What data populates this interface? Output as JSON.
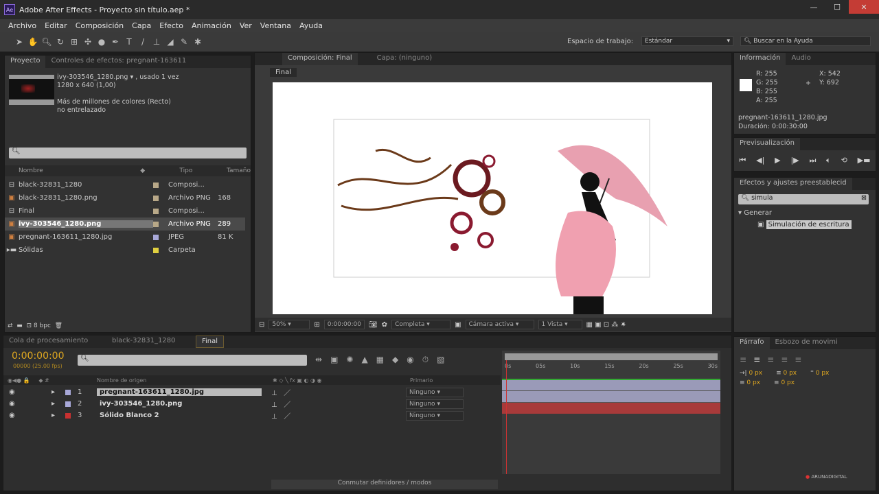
{
  "window": {
    "title": "Adobe After Effects - Proyecto sin título.aep *",
    "logo": "Ae"
  },
  "menu": [
    "Archivo",
    "Editar",
    "Composición",
    "Capa",
    "Efecto",
    "Animación",
    "Ver",
    "Ventana",
    "Ayuda"
  ],
  "toolbar": {
    "workspace_label": "Espacio de trabajo:",
    "workspace_value": "Estándar",
    "help_search": "Buscar en la Ayuda"
  },
  "project": {
    "tab": "Proyecto",
    "effects_tab": "Controles de efectos: pregnant-163611",
    "selected_name": "ivy-303546_1280.png ▾ , usado 1 vez",
    "selected_dims": "1280 x 640 (1,00)",
    "selected_color": "Más de millones de colores (Recto)",
    "selected_interlace": "no entrelazado",
    "columns": {
      "name": "Nombre",
      "type": "Tipo",
      "size": "Tamaño"
    },
    "items": [
      {
        "name": "black-32831_1280",
        "type": "Composi...",
        "size": "",
        "color": "#b8a888",
        "icon": "comp"
      },
      {
        "name": "black-32831_1280.png",
        "type": "Archivo PNG",
        "size": "168",
        "color": "#b8a888",
        "icon": "image"
      },
      {
        "name": "Final",
        "type": "Composi...",
        "size": "",
        "color": "#b8a888",
        "icon": "comp"
      },
      {
        "name": "ivy-303546_1280.png",
        "type": "Archivo PNG",
        "size": "289",
        "color": "#b8a888",
        "icon": "image"
      },
      {
        "name": "pregnant-163611_1280.jpg",
        "type": "JPEG",
        "size": "81 K",
        "color": "#a8a8d8",
        "icon": "image"
      },
      {
        "name": "Sólidas",
        "type": "Carpeta",
        "size": "",
        "color": "#e0d040",
        "icon": "folder"
      }
    ],
    "bpc": "8 bpc"
  },
  "composition": {
    "tab": "Composición: Final",
    "layer_tab": "Capa: (ninguno)",
    "crumb": "Final",
    "zoom": "50%",
    "time": "0:00:00:00",
    "resolution": "Completa",
    "camera": "Cámara activa",
    "views": "1 Vista"
  },
  "info": {
    "tab": "Información",
    "audio_tab": "Audio",
    "r": "255",
    "g": "255",
    "b": "255",
    "a": "255",
    "x": "542",
    "y": "692",
    "file": "pregnant-163611_1280.jpg",
    "duration": "Duración: 0:00:30:00"
  },
  "preview": {
    "tab": "Previsualización"
  },
  "effects": {
    "tab": "Efectos y ajustes preestablecid",
    "search": "simula",
    "category": "Generar",
    "result": "Simulación de escritura"
  },
  "timeline": {
    "tabs": [
      "Cola de procesamiento",
      "black-32831_1280",
      "Final"
    ],
    "time": "0:00:00:00",
    "fps": "00000 (25.00 fps)",
    "col_source": "Nombre de origen",
    "col_parent": "Primario",
    "layers": [
      {
        "num": "1",
        "name": "pregnant-163611_1280.jpg",
        "label": "#a8a8d8",
        "parent": "Ninguno",
        "bar": "#9a9ab8"
      },
      {
        "num": "2",
        "name": "ivy-303546_1280.png",
        "label": "#a8a8d8",
        "parent": "Ninguno",
        "bar": "#9a9ab8"
      },
      {
        "num": "3",
        "name": "Sólido Blanco 2",
        "label": "#c83030",
        "parent": "Ninguno",
        "bar": "#a83a3a"
      }
    ],
    "ruler": [
      "0s",
      "05s",
      "10s",
      "15s",
      "20s",
      "25s",
      "30s"
    ],
    "toggle": "Conmutar definidores / modos"
  },
  "paragraph": {
    "tab": "Párrafo",
    "sketch_tab": "Esbozo de movimi",
    "px1": "0 px",
    "px2": "0 px",
    "px3": "0 px",
    "px4": "0 px",
    "px5": "0 px"
  },
  "watermark": "ARUNADIGITAL"
}
